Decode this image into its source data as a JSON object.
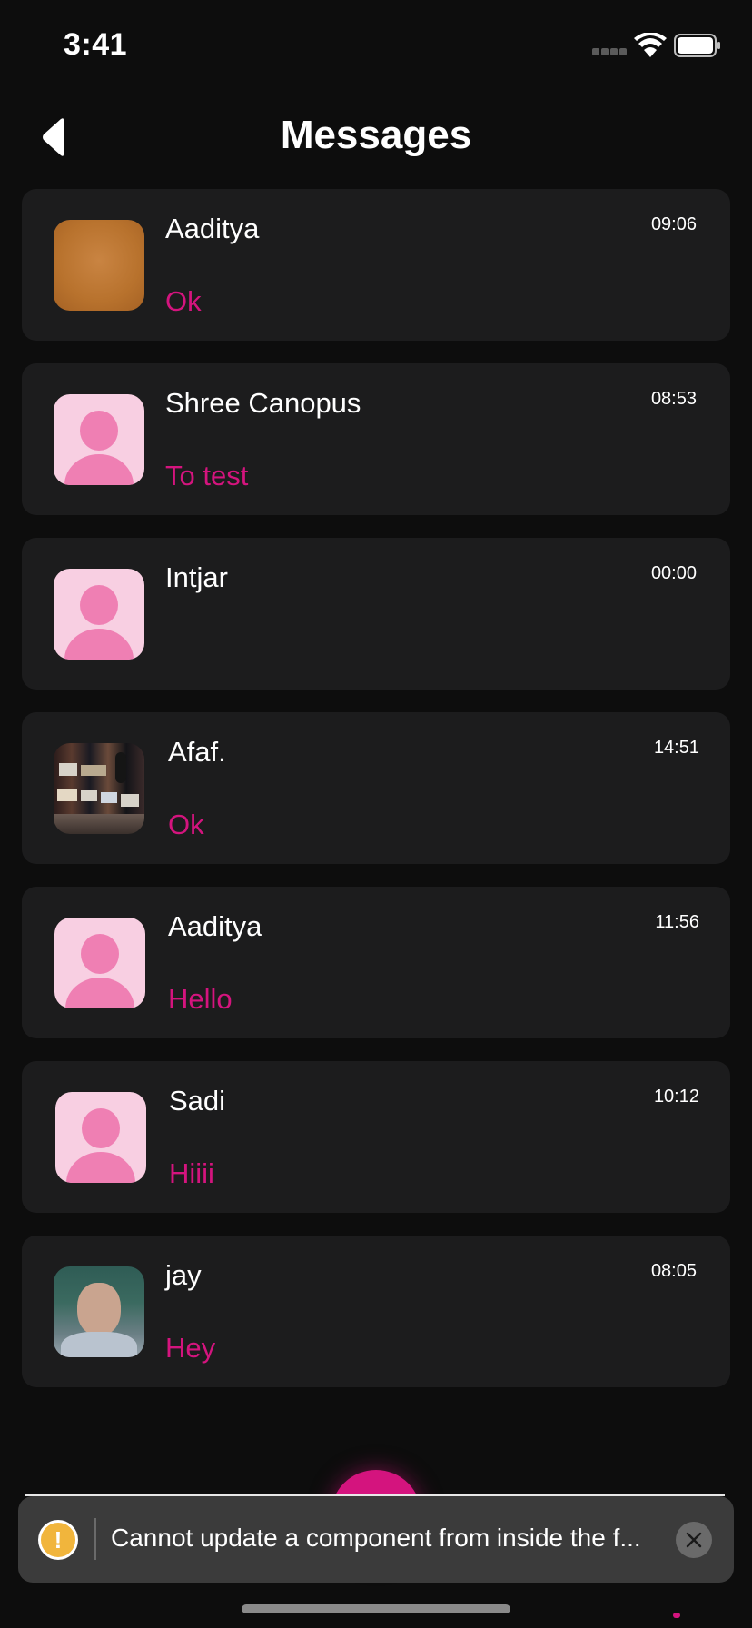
{
  "status_bar": {
    "time": "3:41",
    "icons": [
      "signal-icon",
      "wifi-icon",
      "battery-icon"
    ]
  },
  "header": {
    "title": "Messages",
    "back_icon": "back-arrow-icon"
  },
  "conversations": [
    {
      "name": "Aaditya",
      "message": "Ok",
      "time": "09:06",
      "avatar": "orange-avatar"
    },
    {
      "name": "Shree Canopus",
      "message": "To test",
      "time": "08:53",
      "avatar": "default-avatar"
    },
    {
      "name": "Intjar",
      "message": "",
      "time": "00:00",
      "avatar": "default-avatar"
    },
    {
      "name": "Afaf.",
      "message": "Ok",
      "time": "14:51",
      "avatar": "photo-avatar"
    },
    {
      "name": "Aaditya",
      "message": "Hello",
      "time": "11:56",
      "avatar": "default-avatar"
    },
    {
      "name": "Sadi",
      "message": "Hiiii",
      "time": "10:12",
      "avatar": "default-avatar"
    },
    {
      "name": "jay",
      "message": "Hey",
      "time": "08:05",
      "avatar": "photo-avatar"
    }
  ],
  "toast": {
    "message": "Cannot update a component from inside the f...",
    "icon": "warning-icon"
  },
  "colors": {
    "background": "#0d0d0d",
    "card": "#1c1c1d",
    "accent": "#d4147e",
    "avatar_bg": "#f8cfe2",
    "avatar_fg": "#ef7fb3",
    "toast_bg": "#3b3b3b",
    "warning": "#f1b53c"
  }
}
